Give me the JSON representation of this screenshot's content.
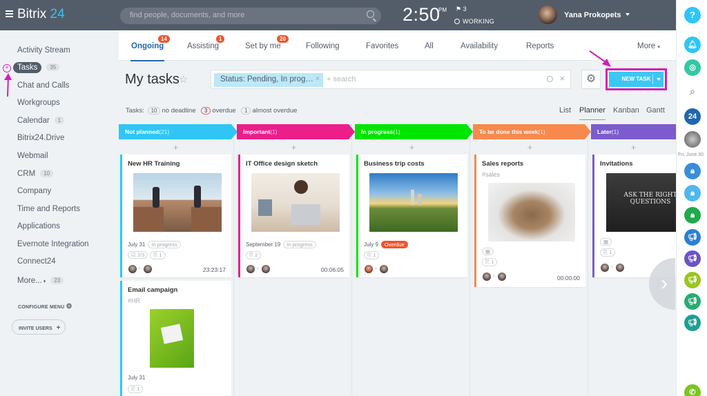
{
  "header": {
    "logo_main": "Bitrix",
    "logo_num": "24",
    "search_placeholder": "find people, documents, and more",
    "time": "2:50",
    "ampm": "PM",
    "flag_count": "3",
    "status": "WORKING",
    "user": "Yana Prokopets"
  },
  "sidebar": {
    "items": [
      {
        "label": "Activity Stream",
        "count": ""
      },
      {
        "label": "Tasks",
        "count": "35"
      },
      {
        "label": "Chat and Calls",
        "count": ""
      },
      {
        "label": "Workgroups",
        "count": ""
      },
      {
        "label": "Calendar",
        "count": "1"
      },
      {
        "label": "Bitrix24.Drive",
        "count": ""
      },
      {
        "label": "Webmail",
        "count": ""
      },
      {
        "label": "CRM",
        "count": "10"
      },
      {
        "label": "Company",
        "count": ""
      },
      {
        "label": "Time and Reports",
        "count": ""
      },
      {
        "label": "Applications",
        "count": ""
      },
      {
        "label": "Evernote Integration",
        "count": ""
      },
      {
        "label": "Connect24",
        "count": ""
      },
      {
        "label": "More...",
        "count": "23"
      }
    ],
    "configure": "CONFIGURE MENU",
    "invite": "INVITE USERS"
  },
  "tabs": [
    {
      "label": "Ongoing",
      "badge": "14"
    },
    {
      "label": "Assisting",
      "badge": "1"
    },
    {
      "label": "Set by me",
      "badge": "20"
    },
    {
      "label": "Following",
      "badge": ""
    },
    {
      "label": "Favorites",
      "badge": ""
    },
    {
      "label": "All",
      "badge": ""
    },
    {
      "label": "Availability",
      "badge": ""
    },
    {
      "label": "Reports",
      "badge": ""
    },
    {
      "label": "More",
      "badge": ""
    }
  ],
  "page": {
    "title": "My tasks",
    "filter_chip": "Status: Pending, In prog…",
    "filter_search": "search",
    "new_task": "NEW TASK"
  },
  "counters": {
    "prefix": "Tasks:",
    "no_deadline_count": "10",
    "no_deadline": "no deadline",
    "overdue_count": "3",
    "overdue": "overdue",
    "almost_count": "1",
    "almost": "almost overdue"
  },
  "views": [
    "List",
    "Planner",
    "Kanban",
    "Gantt"
  ],
  "columns": [
    {
      "title": "Not planned",
      "count": "(21)",
      "color": "#2fc6f6"
    },
    {
      "title": "Important",
      "count": "(1)",
      "color": "#ec1e8a"
    },
    {
      "title": "In progress",
      "count": "(1)",
      "color": "#00e600"
    },
    {
      "title": "To be done this week",
      "count": "(1)",
      "color": "#f7894e"
    },
    {
      "title": "Later",
      "count": "(1)",
      "color": "#7c5ccc"
    }
  ],
  "cards": {
    "c1": {
      "title": "New HR Training",
      "date": "July 31",
      "status": "In progress",
      "checklist": "2/3",
      "files": "1",
      "timer": "23:23:17"
    },
    "c1b": {
      "title": "Email campaign",
      "tag": "#HR",
      "date": "July 31",
      "files": "1"
    },
    "c2": {
      "title": "IT Office design sketch",
      "date": "September 19",
      "status": "In progress",
      "files": "2",
      "timer": "00:06:05"
    },
    "c3": {
      "title": "Business trip costs",
      "date": "July 9",
      "status": "Overdue",
      "files": "1"
    },
    "c4": {
      "title": "Sales reports",
      "tag": "#sales",
      "files": "1",
      "timer": "00:00:00"
    },
    "c5": {
      "title": "Invitations",
      "files": "1",
      "image_text": "ASK THE RIGHT QUESTIONS"
    }
  },
  "rightbar": {
    "help": "?",
    "date": "Fri, June 30",
    "badge24": "24"
  }
}
